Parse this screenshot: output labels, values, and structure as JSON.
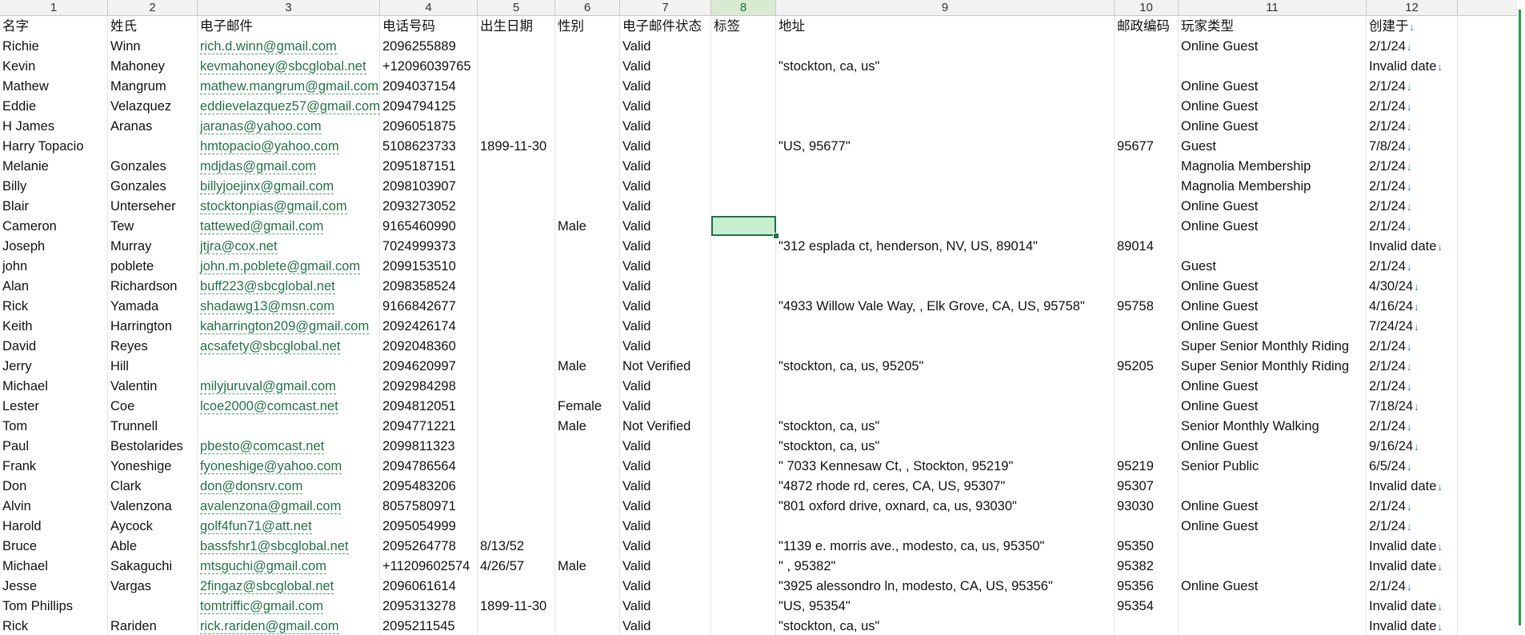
{
  "column_numbers": [
    "1",
    "2",
    "3",
    "4",
    "5",
    "6",
    "7",
    "8",
    "9",
    "10",
    "11",
    "12"
  ],
  "selected_column": "8",
  "headers": [
    "名字",
    "姓氏",
    "电子邮件",
    "电话号码",
    "出生日期",
    "性别",
    "电子邮件状态",
    "标签",
    "地址",
    "邮政编码",
    "玩家类型",
    "创建于"
  ],
  "date_arrow": "↓",
  "rows": [
    {
      "first": "Richie",
      "last": "Winn",
      "email": "rich.d.winn@gmail.com",
      "phone": "2096255889",
      "dob": "",
      "gender": "",
      "status": "Valid",
      "tag": "",
      "address": "",
      "zip": "",
      "type": "Online Guest",
      "created": "2/1/24"
    },
    {
      "first": "Kevin",
      "last": "Mahoney",
      "email": "kevmahoney@sbcglobal.net",
      "phone": "+12096039765",
      "dob": "",
      "gender": "",
      "status": "Valid",
      "tag": "",
      "address": "\"stockton, ca, us\"",
      "zip": "",
      "type": "",
      "created": "Invalid date"
    },
    {
      "first": "Mathew",
      "last": "Mangrum",
      "email": "mathew.mangrum@gmail.com",
      "phone": "2094037154",
      "dob": "",
      "gender": "",
      "status": "Valid",
      "tag": "",
      "address": "",
      "zip": "",
      "type": "Online Guest",
      "created": "2/1/24"
    },
    {
      "first": "Eddie",
      "last": "Velazquez",
      "email": "eddievelazquez57@gmail.com",
      "phone": "2094794125",
      "dob": "",
      "gender": "",
      "status": "Valid",
      "tag": "",
      "address": "",
      "zip": "",
      "type": "Online Guest",
      "created": "2/1/24"
    },
    {
      "first": "H James",
      "last": "Aranas",
      "email": "jaranas@yahoo.com",
      "phone": "2096051875",
      "dob": "",
      "gender": "",
      "status": "Valid",
      "tag": "",
      "address": "",
      "zip": "",
      "type": "Online Guest",
      "created": "2/1/24"
    },
    {
      "first": "Harry Topacio",
      "last": "",
      "email": "hmtopacio@yahoo.com",
      "phone": "5108623733",
      "dob": "1899-11-30",
      "gender": "",
      "status": "Valid",
      "tag": "",
      "address": "\"US, 95677\"",
      "zip": "95677",
      "type": "Guest",
      "created": "7/8/24"
    },
    {
      "first": "Melanie",
      "last": "Gonzales",
      "email": "mdjdas@gmail.com",
      "phone": "2095187151",
      "dob": "",
      "gender": "",
      "status": "Valid",
      "tag": "",
      "address": "",
      "zip": "",
      "type": "Magnolia Membership",
      "created": "2/1/24"
    },
    {
      "first": "Billy",
      "last": "Gonzales",
      "email": "billyjoejinx@gmail.com",
      "phone": "2098103907",
      "dob": "",
      "gender": "",
      "status": "Valid",
      "tag": "",
      "address": "",
      "zip": "",
      "type": "Magnolia Membership",
      "created": "2/1/24"
    },
    {
      "first": "Blair",
      "last": "Unterseher",
      "email": "stocktonpias@gmail.com",
      "phone": "2093273052",
      "dob": "",
      "gender": "",
      "status": "Valid",
      "tag": "",
      "address": "",
      "zip": "",
      "type": "Online Guest",
      "created": "2/1/24"
    },
    {
      "first": "Cameron",
      "last": "Tew",
      "email": "tattewed@gmail.com",
      "phone": "9165460990",
      "dob": "",
      "gender": "Male",
      "status": "Valid",
      "tag": "",
      "address": "",
      "zip": "",
      "type": "Online Guest",
      "created": "2/1/24"
    },
    {
      "first": "Joseph",
      "last": "Murray",
      "email": "jtjra@cox.net",
      "phone": "7024999373",
      "dob": "",
      "gender": "",
      "status": "Valid",
      "tag": "",
      "address": "\"312 esplada ct, henderson, NV, US, 89014\"",
      "zip": "89014",
      "type": "",
      "created": "Invalid date"
    },
    {
      "first": "john",
      "last": "poblete",
      "email": "john.m.poblete@gmail.com",
      "phone": "2099153510",
      "dob": "",
      "gender": "",
      "status": "Valid",
      "tag": "",
      "address": "",
      "zip": "",
      "type": "Guest",
      "created": "2/1/24"
    },
    {
      "first": "Alan",
      "last": "Richardson",
      "email": "buff223@sbcglobal.net",
      "phone": "2098358524",
      "dob": "",
      "gender": "",
      "status": "Valid",
      "tag": "",
      "address": "",
      "zip": "",
      "type": "Online Guest",
      "created": "4/30/24"
    },
    {
      "first": "Rick",
      "last": "Yamada",
      "email": "shadawg13@msn.com",
      "phone": "9166842677",
      "dob": "",
      "gender": "",
      "status": "Valid",
      "tag": "",
      "address": "\"4933 Willow Vale Way, , Elk Grove, CA, US, 95758\"",
      "zip": "95758",
      "type": "Online Guest",
      "created": "4/16/24"
    },
    {
      "first": "Keith",
      "last": "Harrington",
      "email": "kaharrington209@gmail.com",
      "phone": "2092426174",
      "dob": "",
      "gender": "",
      "status": "Valid",
      "tag": "",
      "address": "",
      "zip": "",
      "type": "Online Guest",
      "created": "7/24/24"
    },
    {
      "first": "David",
      "last": "Reyes",
      "email": "acsafety@sbcglobal.net",
      "phone": "2092048360",
      "dob": "",
      "gender": "",
      "status": "Valid",
      "tag": "",
      "address": "",
      "zip": "",
      "type": "Super Senior Monthly Riding",
      "created": "2/1/24"
    },
    {
      "first": "Jerry",
      "last": "Hill",
      "email": "",
      "phone": "2094620997",
      "dob": "",
      "gender": "Male",
      "status": "Not Verified",
      "tag": "",
      "address": "\"stockton, ca, us, 95205\"",
      "zip": "95205",
      "type": "Super Senior Monthly Riding",
      "created": "2/1/24"
    },
    {
      "first": "Michael",
      "last": "Valentin",
      "email": "milyjuruval@gmail.com",
      "phone": "2092984298",
      "dob": "",
      "gender": "",
      "status": "Valid",
      "tag": "",
      "address": "",
      "zip": "",
      "type": "Online Guest",
      "created": "2/1/24"
    },
    {
      "first": "Lester",
      "last": "Coe",
      "email": "lcoe2000@comcast.net",
      "phone": "2094812051",
      "dob": "",
      "gender": "Female",
      "status": "Valid",
      "tag": "",
      "address": "",
      "zip": "",
      "type": "Online Guest",
      "created": "7/18/24"
    },
    {
      "first": "Tom",
      "last": "Trunnell",
      "email": "",
      "phone": "2094771221",
      "dob": "",
      "gender": "Male",
      "status": "Not Verified",
      "tag": "",
      "address": "\"stockton, ca, us\"",
      "zip": "",
      "type": "Senior Monthly Walking",
      "created": "2/1/24"
    },
    {
      "first": "Paul",
      "last": "Bestolarides",
      "email": "pbesto@comcast.net",
      "phone": "2099811323",
      "dob": "",
      "gender": "",
      "status": "Valid",
      "tag": "",
      "address": "\"stockton, ca, us\"",
      "zip": "",
      "type": "Online Guest",
      "created": "9/16/24"
    },
    {
      "first": " Frank",
      "last": "Yoneshige",
      "email": "fyoneshige@yahoo.com",
      "phone": "2094786564",
      "dob": "",
      "gender": "",
      "status": "Valid",
      "tag": "",
      "address": "\" 7033 Kennesaw Ct, ,  Stockton, 95219\"",
      "zip": "95219",
      "type": "Senior Public",
      "created": "6/5/24"
    },
    {
      "first": "Don",
      "last": "Clark",
      "email": "don@donsrv.com",
      "phone": "2095483206",
      "dob": "",
      "gender": "",
      "status": "Valid",
      "tag": "",
      "address": "\"4872 rhode rd, ceres, CA, US, 95307\"",
      "zip": "95307",
      "type": "",
      "created": "Invalid date"
    },
    {
      "first": "Alvin",
      "last": "Valenzona",
      "email": "avalenzona@gmail.com",
      "phone": "8057580971",
      "dob": "",
      "gender": "",
      "status": "Valid",
      "tag": "",
      "address": "\"801 oxford drive, oxnard, ca, us, 93030\"",
      "zip": "93030",
      "type": "Online Guest",
      "created": "2/1/24"
    },
    {
      "first": "Harold",
      "last": "Aycock",
      "email": "golf4fun71@att.net",
      "phone": "2095054999",
      "dob": "",
      "gender": "",
      "status": "Valid",
      "tag": "",
      "address": "",
      "zip": "",
      "type": "Online Guest",
      "created": "2/1/24"
    },
    {
      "first": "Bruce",
      "last": "Able",
      "email": "bassfshr1@sbcglobal.net",
      "phone": "2095264778",
      "dob": "8/13/52",
      "gender": "",
      "status": "Valid",
      "tag": "",
      "address": "\"1139 e. morris ave., modesto, ca, us, 95350\"",
      "zip": "95350",
      "type": "",
      "created": "Invalid date"
    },
    {
      "first": "Michael",
      "last": "Sakaguchi",
      "email": "mtsguchi@gmail.com",
      "phone": "+11209602574",
      "dob": "4/26/57",
      "gender": "Male",
      "status": "Valid",
      "tag": "",
      "address": "\" , 95382\"",
      "zip": "95382",
      "type": "",
      "created": "Invalid date"
    },
    {
      "first": "Jesse",
      "last": "Vargas",
      "email": "2fingaz@sbcglobal.net",
      "phone": "2096061614",
      "dob": "",
      "gender": "",
      "status": "Valid",
      "tag": "",
      "address": "\"3925 alessondro ln, modesto, CA, US, 95356\"",
      "zip": "95356",
      "type": "Online Guest",
      "created": "2/1/24"
    },
    {
      "first": "Tom Phillips",
      "last": "",
      "email": "tomtriffic@gmail.com",
      "phone": "2095313278",
      "dob": "1899-11-30",
      "gender": "",
      "status": "Valid",
      "tag": "",
      "address": "\"US, 95354\"",
      "zip": "95354",
      "type": "",
      "created": "Invalid date"
    },
    {
      "first": "Rick",
      "last": "Rariden",
      "email": "rick.rariden@gmail.com",
      "phone": "2095211545",
      "dob": "",
      "gender": "",
      "status": "Valid",
      "tag": "",
      "address": "\"stockton, ca, us\"",
      "zip": "",
      "type": "",
      "created": "Invalid date"
    }
  ],
  "colors": {
    "link": "#217346",
    "selection_fill": "#c6efce",
    "selection_border": "#217346",
    "date_arrow": "#2f6fd6"
  }
}
